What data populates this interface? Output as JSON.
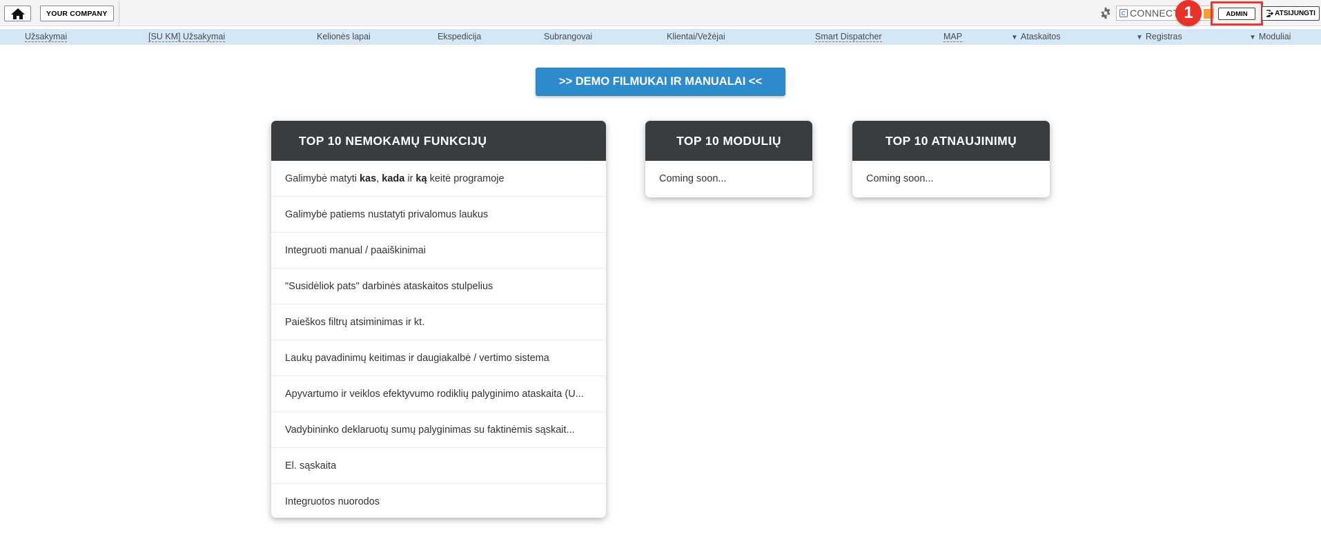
{
  "topbar": {
    "company_label": "YOUR COMPANY",
    "connect_label": "CONNECT",
    "badge_number": "1",
    "admin_label": "ADMIN",
    "logout_label": "ATSIJUNGTI",
    "highlight_color": "#e53935"
  },
  "nav": {
    "items": [
      {
        "label": "Užsakymai"
      },
      {
        "label": "[SU KM] Užsakymai"
      },
      {
        "label": "Kelionės lapai"
      },
      {
        "label": "Ekspedicija"
      },
      {
        "label": "Subrangovai"
      },
      {
        "label": "Klientai/Vežėjai"
      },
      {
        "label": "Smart Dispatcher"
      },
      {
        "label": "MAP"
      },
      {
        "label": "Ataskaitos",
        "arrow": "▼"
      },
      {
        "label": "Registras",
        "arrow": "▼"
      },
      {
        "label": "Moduliai",
        "arrow": "▼"
      }
    ]
  },
  "demo_button": {
    "label": ">> DEMO FILMUKAI IR MANUALAI <<"
  },
  "cards": {
    "free_functions": {
      "title": "TOP 10 NEMOKAMŲ FUNKCIJŲ",
      "rows": [
        {
          "pre": "Galimybė matyti ",
          "b1": "kas",
          "s1": ", ",
          "b2": "kada",
          "s2": " ir ",
          "b3": "ką",
          "post": " keitė programoje"
        },
        {
          "text": "Galimybė patiems nustatyti privalomus laukus"
        },
        {
          "text": "Integruoti manual / paaiškinimai"
        },
        {
          "text": "\"Susidėliok pats\" darbinės ataskaitos stulpelius"
        },
        {
          "text": "Paieškos filtrų atsiminimas ir kt."
        },
        {
          "text": "Laukų pavadinimų keitimas ir daugiakalbė / vertimo sistema"
        },
        {
          "text": "Apyvartumo ir veiklos efektyvumo rodiklių palyginimo ataskaita (U..."
        },
        {
          "text": "Vadybininko deklaruotų sumų palyginimas su faktinėmis sąskait..."
        },
        {
          "text": "El. sąskaita"
        },
        {
          "text": "Integruotos nuorodos"
        }
      ]
    },
    "modules": {
      "title": "TOP 10 MODULIŲ",
      "text": "Coming soon..."
    },
    "updates": {
      "title": "TOP 10 ATNAUJINIMŲ",
      "text": "Coming soon..."
    }
  }
}
